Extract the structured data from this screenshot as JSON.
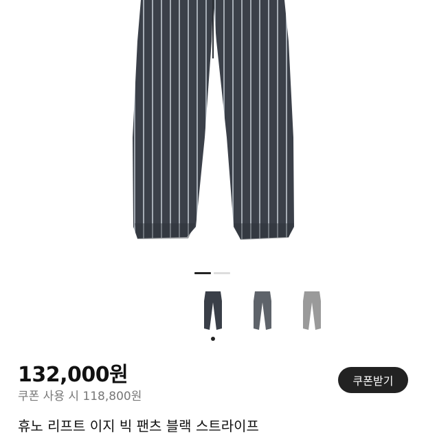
{
  "product": {
    "price": "132,000원",
    "coupon_price_text": "쿠폰 사용 시 118,800원",
    "coupon_button": "쿠폰받기",
    "title": "휴노 리프트 이지 빅 팬츠 블랙 스트라이프"
  },
  "gallery": {
    "pages": 2,
    "active_page": 1,
    "thumbnails": [
      {
        "name": "thumb-black-stripe",
        "color": "#3a3f48"
      },
      {
        "name": "thumb-charcoal",
        "color": "#5e636a"
      },
      {
        "name": "thumb-gray",
        "color": "#9a9a9a"
      }
    ],
    "selected_thumbnail": 0
  },
  "colors": {
    "pants_main": "#3b4049",
    "stripe": "#b9c0c8",
    "button_bg": "#222222"
  }
}
